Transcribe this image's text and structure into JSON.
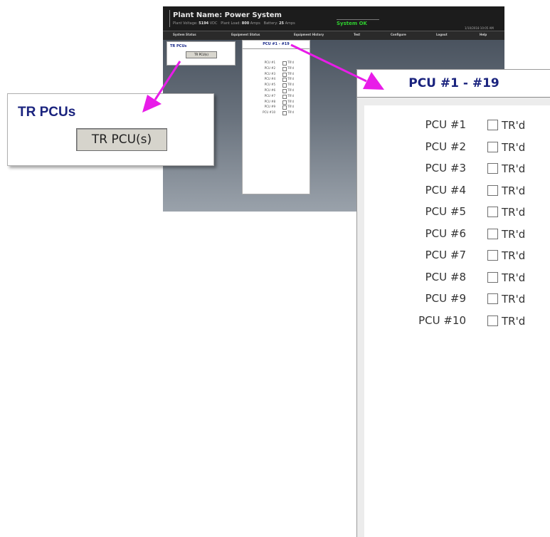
{
  "screen": {
    "plant_name": "Plant Name: Power System",
    "stats": [
      {
        "label": "Plant Voltage:",
        "value": "5194",
        "unit": "VDC"
      },
      {
        "label": "Plant Load:",
        "value": "800",
        "unit": "Amps"
      },
      {
        "label": "Battery:",
        "value": "25",
        "unit": "Amps"
      }
    ],
    "system_status": "System OK",
    "datetime": "1/10/2018 10:05 AM",
    "nav": [
      "System Status",
      "Equipment Status",
      "Equipment History",
      "Test",
      "Configure",
      "Logout",
      "Help"
    ],
    "mini_tr_title": "TR PCUs",
    "mini_tr_button": "TR PCU(s)",
    "mini_pcu_title": "PCU #1 - #19"
  },
  "tr_panel": {
    "title": "TR PCUs",
    "button_label": "TR PCU(s)"
  },
  "pcu_panel": {
    "title": "PCU #1 - #19",
    "rows": [
      {
        "label": "PCU #1",
        "checkbox_label": "TR'd",
        "checked": false
      },
      {
        "label": "PCU #2",
        "checkbox_label": "TR'd",
        "checked": false
      },
      {
        "label": "PCU #3",
        "checkbox_label": "TR'd",
        "checked": false
      },
      {
        "label": "PCU #4",
        "checkbox_label": "TR'd",
        "checked": false
      },
      {
        "label": "PCU #5",
        "checkbox_label": "TR'd",
        "checked": false
      },
      {
        "label": "PCU #6",
        "checkbox_label": "TR'd",
        "checked": false
      },
      {
        "label": "PCU #7",
        "checkbox_label": "TR'd",
        "checked": false
      },
      {
        "label": "PCU #8",
        "checkbox_label": "TR'd",
        "checked": false
      },
      {
        "label": "PCU #9",
        "checkbox_label": "TR'd",
        "checked": false
      },
      {
        "label": "PCU #10",
        "checkbox_label": "TR'd",
        "checked": false
      }
    ]
  },
  "colors": {
    "title_blue": "#1a237e",
    "status_green": "#2fcf2f",
    "arrow_magenta": "#e81ce8"
  }
}
